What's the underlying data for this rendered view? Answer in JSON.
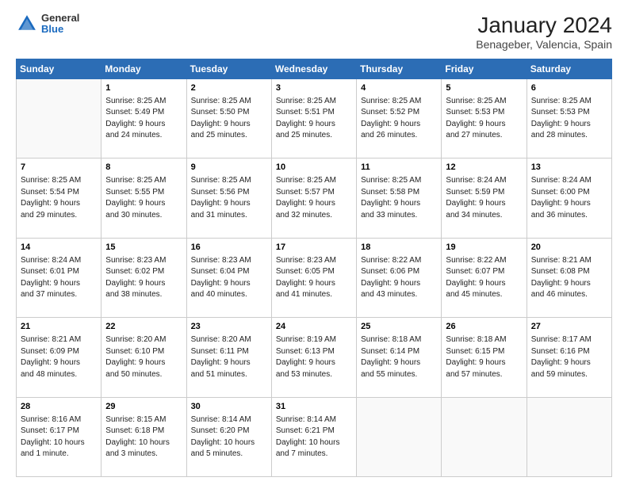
{
  "header": {
    "logo": {
      "general": "General",
      "blue": "Blue"
    },
    "title": "January 2024",
    "subtitle": "Benageber, Valencia, Spain"
  },
  "calendar": {
    "days_of_week": [
      "Sunday",
      "Monday",
      "Tuesday",
      "Wednesday",
      "Thursday",
      "Friday",
      "Saturday"
    ],
    "weeks": [
      [
        {
          "day": "",
          "info": ""
        },
        {
          "day": "1",
          "info": "Sunrise: 8:25 AM\nSunset: 5:49 PM\nDaylight: 9 hours\nand 24 minutes."
        },
        {
          "day": "2",
          "info": "Sunrise: 8:25 AM\nSunset: 5:50 PM\nDaylight: 9 hours\nand 25 minutes."
        },
        {
          "day": "3",
          "info": "Sunrise: 8:25 AM\nSunset: 5:51 PM\nDaylight: 9 hours\nand 25 minutes."
        },
        {
          "day": "4",
          "info": "Sunrise: 8:25 AM\nSunset: 5:52 PM\nDaylight: 9 hours\nand 26 minutes."
        },
        {
          "day": "5",
          "info": "Sunrise: 8:25 AM\nSunset: 5:53 PM\nDaylight: 9 hours\nand 27 minutes."
        },
        {
          "day": "6",
          "info": "Sunrise: 8:25 AM\nSunset: 5:53 PM\nDaylight: 9 hours\nand 28 minutes."
        }
      ],
      [
        {
          "day": "7",
          "info": "Sunrise: 8:25 AM\nSunset: 5:54 PM\nDaylight: 9 hours\nand 29 minutes."
        },
        {
          "day": "8",
          "info": "Sunrise: 8:25 AM\nSunset: 5:55 PM\nDaylight: 9 hours\nand 30 minutes."
        },
        {
          "day": "9",
          "info": "Sunrise: 8:25 AM\nSunset: 5:56 PM\nDaylight: 9 hours\nand 31 minutes."
        },
        {
          "day": "10",
          "info": "Sunrise: 8:25 AM\nSunset: 5:57 PM\nDaylight: 9 hours\nand 32 minutes."
        },
        {
          "day": "11",
          "info": "Sunrise: 8:25 AM\nSunset: 5:58 PM\nDaylight: 9 hours\nand 33 minutes."
        },
        {
          "day": "12",
          "info": "Sunrise: 8:24 AM\nSunset: 5:59 PM\nDaylight: 9 hours\nand 34 minutes."
        },
        {
          "day": "13",
          "info": "Sunrise: 8:24 AM\nSunset: 6:00 PM\nDaylight: 9 hours\nand 36 minutes."
        }
      ],
      [
        {
          "day": "14",
          "info": "Sunrise: 8:24 AM\nSunset: 6:01 PM\nDaylight: 9 hours\nand 37 minutes."
        },
        {
          "day": "15",
          "info": "Sunrise: 8:23 AM\nSunset: 6:02 PM\nDaylight: 9 hours\nand 38 minutes."
        },
        {
          "day": "16",
          "info": "Sunrise: 8:23 AM\nSunset: 6:04 PM\nDaylight: 9 hours\nand 40 minutes."
        },
        {
          "day": "17",
          "info": "Sunrise: 8:23 AM\nSunset: 6:05 PM\nDaylight: 9 hours\nand 41 minutes."
        },
        {
          "day": "18",
          "info": "Sunrise: 8:22 AM\nSunset: 6:06 PM\nDaylight: 9 hours\nand 43 minutes."
        },
        {
          "day": "19",
          "info": "Sunrise: 8:22 AM\nSunset: 6:07 PM\nDaylight: 9 hours\nand 45 minutes."
        },
        {
          "day": "20",
          "info": "Sunrise: 8:21 AM\nSunset: 6:08 PM\nDaylight: 9 hours\nand 46 minutes."
        }
      ],
      [
        {
          "day": "21",
          "info": "Sunrise: 8:21 AM\nSunset: 6:09 PM\nDaylight: 9 hours\nand 48 minutes."
        },
        {
          "day": "22",
          "info": "Sunrise: 8:20 AM\nSunset: 6:10 PM\nDaylight: 9 hours\nand 50 minutes."
        },
        {
          "day": "23",
          "info": "Sunrise: 8:20 AM\nSunset: 6:11 PM\nDaylight: 9 hours\nand 51 minutes."
        },
        {
          "day": "24",
          "info": "Sunrise: 8:19 AM\nSunset: 6:13 PM\nDaylight: 9 hours\nand 53 minutes."
        },
        {
          "day": "25",
          "info": "Sunrise: 8:18 AM\nSunset: 6:14 PM\nDaylight: 9 hours\nand 55 minutes."
        },
        {
          "day": "26",
          "info": "Sunrise: 8:18 AM\nSunset: 6:15 PM\nDaylight: 9 hours\nand 57 minutes."
        },
        {
          "day": "27",
          "info": "Sunrise: 8:17 AM\nSunset: 6:16 PM\nDaylight: 9 hours\nand 59 minutes."
        }
      ],
      [
        {
          "day": "28",
          "info": "Sunrise: 8:16 AM\nSunset: 6:17 PM\nDaylight: 10 hours\nand 1 minute."
        },
        {
          "day": "29",
          "info": "Sunrise: 8:15 AM\nSunset: 6:18 PM\nDaylight: 10 hours\nand 3 minutes."
        },
        {
          "day": "30",
          "info": "Sunrise: 8:14 AM\nSunset: 6:20 PM\nDaylight: 10 hours\nand 5 minutes."
        },
        {
          "day": "31",
          "info": "Sunrise: 8:14 AM\nSunset: 6:21 PM\nDaylight: 10 hours\nand 7 minutes."
        },
        {
          "day": "",
          "info": ""
        },
        {
          "day": "",
          "info": ""
        },
        {
          "day": "",
          "info": ""
        }
      ]
    ]
  }
}
